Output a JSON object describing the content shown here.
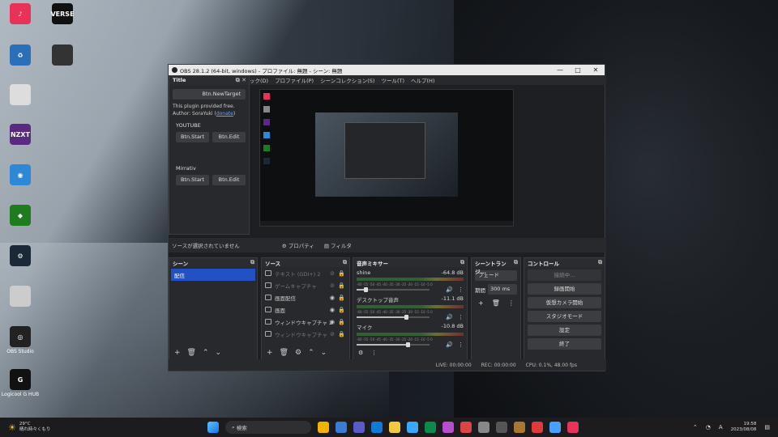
{
  "desktop_icons": [
    {
      "name": "tiktok",
      "label": "",
      "color": "#e8325a",
      "text": "♪"
    },
    {
      "name": "verse",
      "label": "",
      "color": "#111111",
      "text": "VERSE"
    },
    {
      "name": "recycle",
      "label": "",
      "color": "#2a6fb7",
      "text": "♻"
    },
    {
      "name": "game",
      "label": "",
      "color": "#333333",
      "text": ""
    },
    {
      "name": "doc",
      "label": "",
      "color": "#dddddd",
      "text": ""
    },
    {
      "name": "nzxt",
      "label": "",
      "color": "#5a2a82",
      "text": "NZXT"
    },
    {
      "name": "globe",
      "label": "",
      "color": "#2e88d6",
      "text": "◉"
    },
    {
      "name": "nvidia",
      "label": "",
      "color": "#1e7b1e",
      "text": "◆"
    },
    {
      "name": "steam",
      "label": "",
      "color": "#1b2838",
      "text": "⚙"
    },
    {
      "name": "blank",
      "label": "",
      "color": "#cccccc",
      "text": ""
    },
    {
      "name": "obs",
      "label": "OBS Studio",
      "color": "#222222",
      "text": "◎"
    },
    {
      "name": "logi",
      "label": "Logicool G HUB",
      "color": "#111111",
      "text": "G"
    }
  ],
  "window": {
    "title": "OBS 28.1.2 (64-bit, windows) - プロファイル: 無題 - シーン: 無題",
    "min": "—",
    "max": "□",
    "close": "✕"
  },
  "menu": [
    "ック(D)",
    "プロファイル(P)",
    "シーンコレクション(S)",
    "ツール(T)",
    "ヘルプ(H)"
  ],
  "plugin": {
    "title": "Title",
    "target_btn": "Btn.NewTarget",
    "line1": "This plugin provided free.",
    "line2_prefix": "Author: SoraYuki (",
    "line2_link": "donate",
    "line2_suffix": ")",
    "sections": [
      {
        "name": "YOUTUBE",
        "start": "Btn.Start",
        "edit": "Btn.Edit"
      },
      {
        "name": "Mirrativ",
        "start": "Btn.Start",
        "edit": "Btn.Edit"
      }
    ]
  },
  "source_bar": {
    "status": "ソースが選択されていません",
    "props": "プロパティ",
    "filters": "フィルタ"
  },
  "scenes": {
    "title": "シーン",
    "items": [
      "配信"
    ]
  },
  "sources": {
    "title": "ソース",
    "items": [
      {
        "label": "テキスト (GDI+) 2",
        "visible": false
      },
      {
        "label": "ゲームキャプチャ",
        "visible": false
      },
      {
        "label": "画面配信",
        "visible": true
      },
      {
        "label": "画面",
        "visible": true
      },
      {
        "label": "ウィンドウキャプチャ 2",
        "visible": true
      },
      {
        "label": "ウィンドウキャプチャ",
        "visible": false
      }
    ]
  },
  "mixer": {
    "title": "音声ミキサー",
    "channels": [
      {
        "name": "shine",
        "db": "-64.8 dB",
        "level": 0.12
      },
      {
        "name": "デスクトップ音声",
        "db": "-11.1 dB",
        "level": 0.68
      },
      {
        "name": "マイク",
        "db": "-10.8 dB",
        "level": 0.7
      }
    ],
    "scale": "-60 -55 -50 -45 -40 -35 -30 -25 -20 -15 -10 -5 0"
  },
  "transitions": {
    "title": "シーントランジ...",
    "type": "フェード",
    "duration_label": "期間",
    "duration": "300 ms"
  },
  "controls": {
    "title": "コントロール",
    "buttons": [
      "接続中...",
      "録画開始",
      "仮想カメラ開始",
      "スタジオモード",
      "設定",
      "終了"
    ]
  },
  "status": {
    "live": "LIVE: 00:00:00",
    "rec": "REC: 00:00:00",
    "cpu": "CPU: 0.1%, 48.00 fps"
  },
  "taskbar": {
    "weather_temp": "29°C",
    "weather_desc": "晴れ時々くもり",
    "search": "検索",
    "time": "19:58",
    "date": "2023/08/08"
  }
}
